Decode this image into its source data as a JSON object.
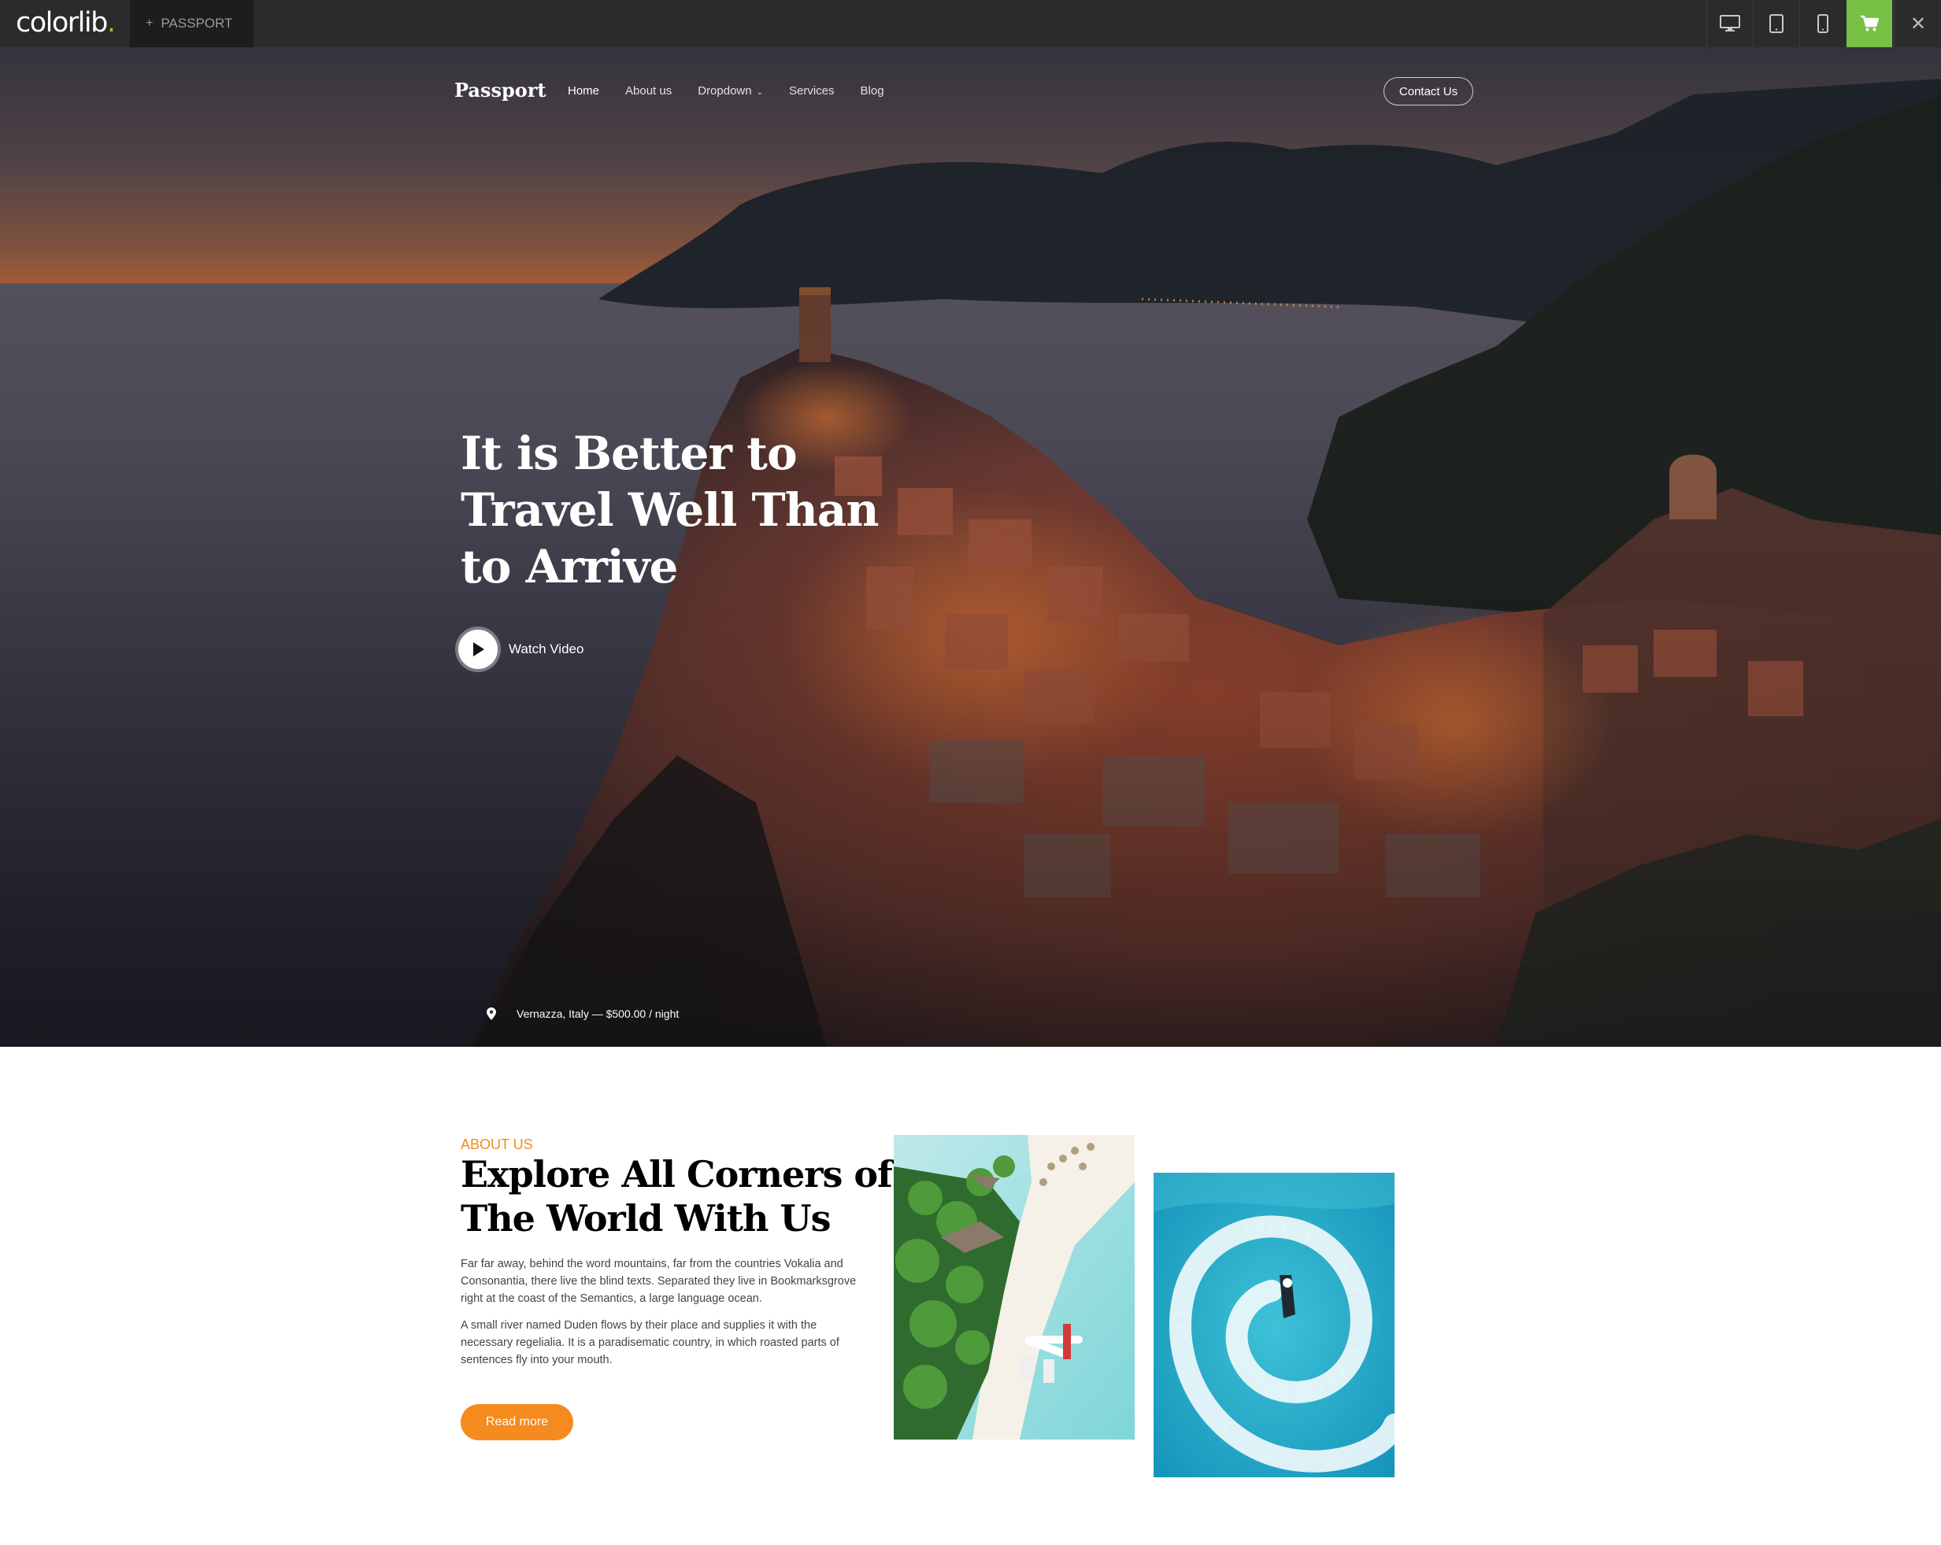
{
  "preview_bar": {
    "logo": "colorlib",
    "logo_dot": ".",
    "project_tab": "PASSPORT",
    "plus": "+",
    "icons": [
      "desktop-icon",
      "tablet-icon",
      "mobile-icon",
      "cart-icon",
      "close-icon"
    ],
    "close_glyph": "✕",
    "accent": "#76c043"
  },
  "nav": {
    "brand": "Passport",
    "links": [
      "Home",
      "About us",
      "Dropdown",
      "Services",
      "Blog"
    ],
    "dropdown_caret": "⌄",
    "contact": "Contact Us"
  },
  "hero": {
    "title": "It is Better to Travel Well Than to Arrive",
    "watch_label": "Watch Video",
    "location": "Vernazza, Italy — $500.00 / night"
  },
  "about": {
    "eyebrow": "ABOUT US",
    "title": "Explore All Corners of The World With Us",
    "paragraph1": "Far far away, behind the word mountains, far from the countries Vokalia and Consonantia, there live the blind texts. Separated they live in Bookmarksgrove right at the coast of the Semantics, a large language ocean.",
    "paragraph2": "A small river named Duden flows by their place and supplies it with the necessary regelialia. It is a paradisematic country, in which roasted parts of sentences fly into your mouth.",
    "read_more": "Read more",
    "accent": "#f58a1f"
  }
}
